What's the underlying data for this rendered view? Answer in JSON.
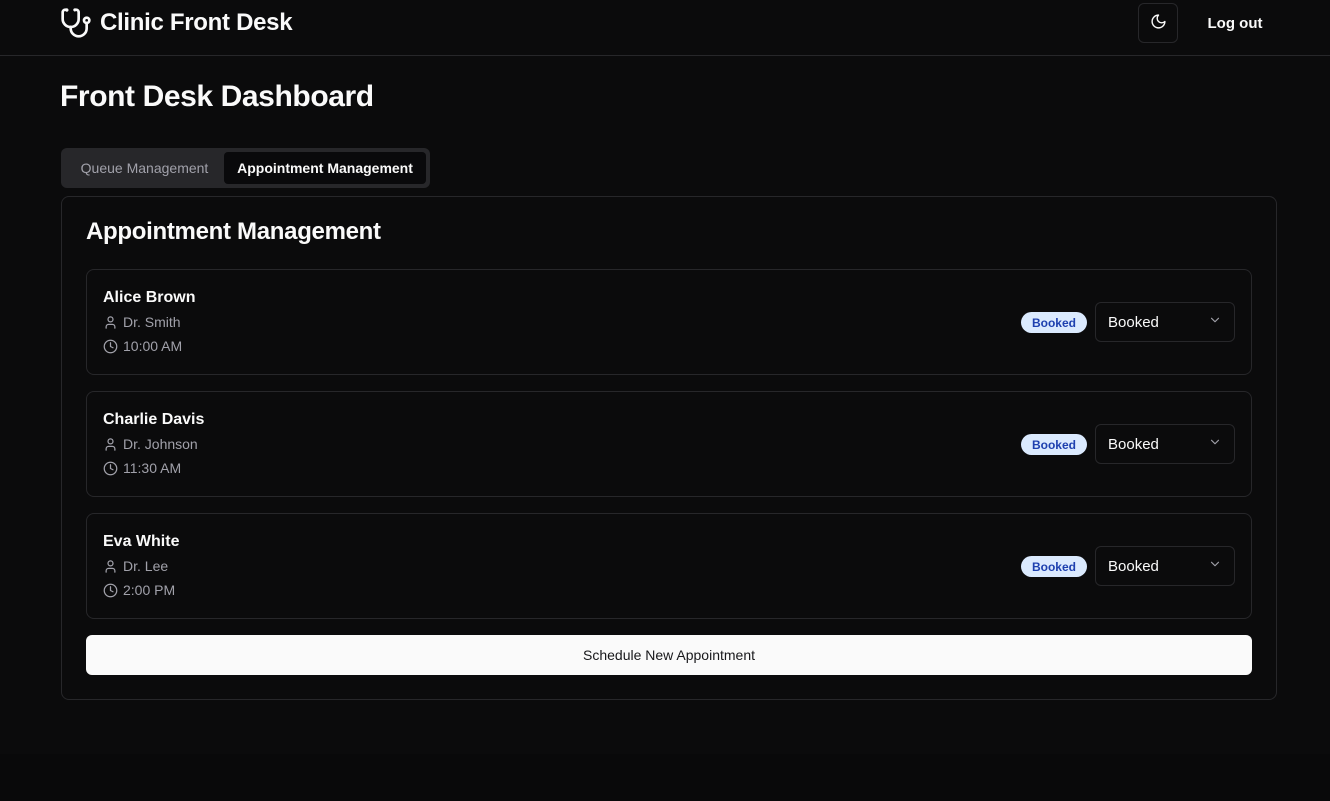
{
  "header": {
    "brand_icon": "stethoscope-icon",
    "title": "Clinic Front Desk",
    "theme_toggle_icon": "moon-icon",
    "logout_label": "Log out"
  },
  "page": {
    "title": "Front Desk Dashboard"
  },
  "tabs": [
    {
      "label": "Queue Management",
      "active": false
    },
    {
      "label": "Appointment Management",
      "active": true
    }
  ],
  "appointments_panel": {
    "title": "Appointment Management",
    "items": [
      {
        "patient": "Alice Brown",
        "doctor": "Dr. Smith",
        "time": "10:00 AM",
        "badge": "Booked",
        "status_value": "Booked"
      },
      {
        "patient": "Charlie Davis",
        "doctor": "Dr. Johnson",
        "time": "11:30 AM",
        "badge": "Booked",
        "status_value": "Booked"
      },
      {
        "patient": "Eva White",
        "doctor": "Dr. Lee",
        "time": "2:00 PM",
        "badge": "Booked",
        "status_value": "Booked"
      }
    ],
    "schedule_button": "Schedule New Appointment"
  },
  "colors": {
    "background": "#0b0b0c",
    "border": "#27272a",
    "badge_bg": "#dbeafe",
    "badge_text": "#1e40af",
    "primary_button_bg": "#fafafa"
  }
}
